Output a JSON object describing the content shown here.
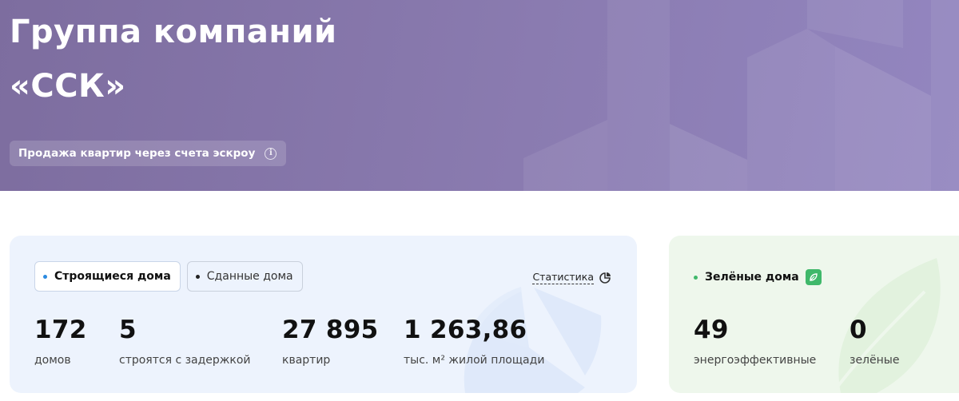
{
  "hero": {
    "title": "Группа компаний\n«ССК»",
    "escrow_label": "Продажа квартир через счета эскроу",
    "info_glyph": "i",
    "background_color": "#8a7bb0"
  },
  "building_card": {
    "tabs": [
      {
        "label": "Строящиеся дома",
        "active": true,
        "dot_color": "#2b8ae0"
      },
      {
        "label": "Сданные дома",
        "active": false,
        "dot_color": "#222222"
      }
    ],
    "statistics_link": "Статистика",
    "statistics_icon": "pie-chart-icon",
    "metrics": [
      {
        "value": "172",
        "label": "домов"
      },
      {
        "value": "5",
        "label": "строятся с задержкой"
      },
      {
        "value": "27 895",
        "label": "квартир"
      },
      {
        "value": "1 263,86",
        "label": "тыс. м² жилой площади"
      }
    ],
    "background_color": "#edf3fd"
  },
  "green_card": {
    "title": "Зелёные дома",
    "dot_color": "#3fb86a",
    "badge_icon": "leaf-icon",
    "metrics": [
      {
        "value": "49",
        "label": "энергоэффективные"
      },
      {
        "value": "0",
        "label": "зелёные"
      }
    ],
    "background_color": "#eef7ec"
  }
}
